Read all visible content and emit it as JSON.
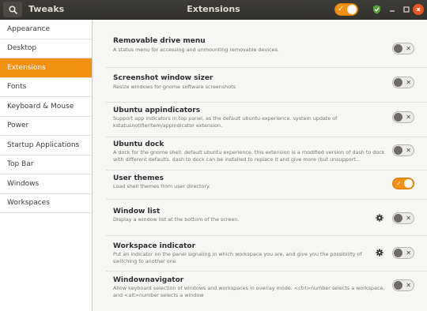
{
  "header": {
    "app_title": "Tweaks",
    "page_title": "Extensions",
    "global_switch_on": true
  },
  "sidebar": {
    "items": [
      {
        "label": "Appearance"
      },
      {
        "label": "Desktop"
      },
      {
        "label": "Extensions",
        "selected": true
      },
      {
        "label": "Fonts"
      },
      {
        "label": "Keyboard & Mouse"
      },
      {
        "label": "Power"
      },
      {
        "label": "Startup Applications"
      },
      {
        "label": "Top Bar"
      },
      {
        "label": "Windows"
      },
      {
        "label": "Workspaces"
      }
    ]
  },
  "extensions": [
    {
      "name": "Removable drive menu",
      "desc": "A status menu for accessing and unmounting removable devices.",
      "enabled": false,
      "has_settings": false
    },
    {
      "name": "Screenshot window sizer",
      "desc": "Resize windows for gnome software screenshots",
      "enabled": false,
      "has_settings": false
    },
    {
      "name": "Ubuntu appindicators",
      "desc": "Support app indicators in top panel, as the default ubuntu experience. system update of kstatusnotifieritem/appindicator extension.",
      "enabled": false,
      "has_settings": false
    },
    {
      "name": "Ubuntu dock",
      "desc": "A dock for the gnome shell. default ubuntu experience. this extension is a modified version of dash to dock with different defaults. dash to dock can be installed to replace it and give more (but unsupport...",
      "enabled": false,
      "has_settings": false
    },
    {
      "name": "User themes",
      "desc": "Load shell themes from user directory.",
      "enabled": true,
      "has_settings": false
    },
    {
      "name": "Window list",
      "desc": "Display a window list at the bottom of the screen.",
      "enabled": false,
      "has_settings": true
    },
    {
      "name": "Workspace indicator",
      "desc": "Put an indicator on the panel signaling in which workspace you are, and give you the possibility of switching to another one",
      "enabled": false,
      "has_settings": true
    },
    {
      "name": "Windownavigator",
      "desc": "Allow keyboard selection of windows and workspaces in overlay mode. <ctrl>number selects a workspace, and <alt>number selects a window",
      "enabled": false,
      "has_settings": false
    }
  ],
  "colors": {
    "accent": "#f29111",
    "header_bg": "#3c3b37",
    "close_button": "#e9541f"
  }
}
